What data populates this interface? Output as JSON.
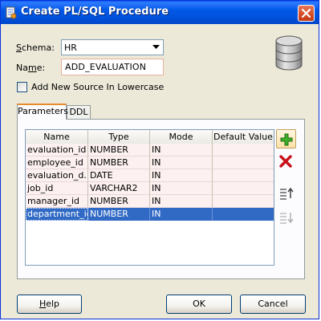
{
  "window": {
    "title": "Create PL/SQL Procedure",
    "title_icon": "oracle-procedure-icon",
    "close_icon": "close-x-icon"
  },
  "form": {
    "schema_label_accel": "S",
    "schema_label_rest": "chema:",
    "schema_value": "HR",
    "name_label_pre": "Na",
    "name_label_accel": "m",
    "name_label_rest": "e:",
    "name_value": "ADD_EVALUATION",
    "lowercase_checkbox_label": "Add New Source In Lowercase",
    "lowercase_checked": false,
    "database_icon": "database-cylinder-icon"
  },
  "tabs": [
    {
      "label": "Parameters",
      "active": true
    },
    {
      "label": "DDL",
      "active": false
    }
  ],
  "table": {
    "columns": [
      "Name",
      "Type",
      "Mode",
      "Default Value"
    ],
    "rows": [
      {
        "name": "evaluation_id",
        "type": "NUMBER",
        "mode": "IN",
        "default": ""
      },
      {
        "name": "employee_id",
        "type": "NUMBER",
        "mode": "IN",
        "default": ""
      },
      {
        "name": "evaluation_d...",
        "type": "DATE",
        "mode": "IN",
        "default": ""
      },
      {
        "name": "job_id",
        "type": "VARCHAR2",
        "mode": "IN",
        "default": ""
      },
      {
        "name": "manager_id",
        "type": "NUMBER",
        "mode": "IN",
        "default": ""
      },
      {
        "name": "department_id",
        "type": "NUMBER",
        "mode": "IN",
        "default": ""
      }
    ],
    "selected_row": 5
  },
  "side_buttons": [
    {
      "icon": "add-plus-icon",
      "enabled": true
    },
    {
      "icon": "remove-x-icon",
      "enabled": true
    },
    {
      "icon": "move-up-icon",
      "enabled": true
    },
    {
      "icon": "move-down-icon",
      "enabled": false
    }
  ],
  "buttons": {
    "help_accel": "H",
    "help_rest": "elp",
    "ok": "OK",
    "cancel": "Cancel"
  },
  "colors": {
    "titlebar": "#0054e3",
    "selection": "#316ac5",
    "row_tint": "#fcf0f0",
    "dialog_bg": "#ece9d8"
  }
}
